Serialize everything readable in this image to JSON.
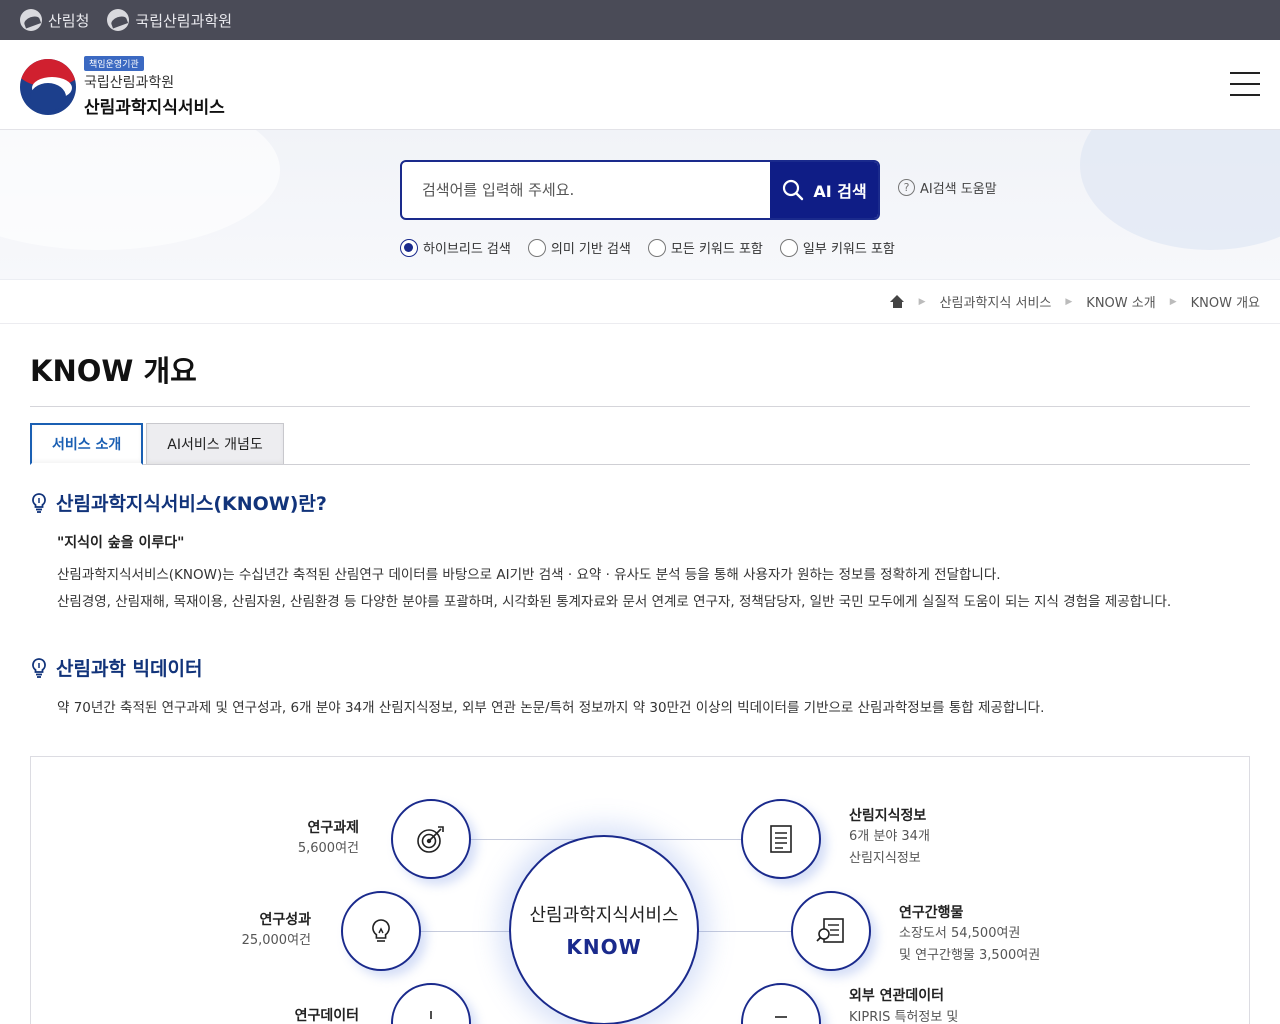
{
  "topbar": {
    "links": [
      "산림청",
      "국립산림과학원"
    ]
  },
  "header": {
    "badge": "책임운영기관",
    "org": "국립산림과학원",
    "service": "산림과학지식서비스"
  },
  "search": {
    "placeholder": "검색어를 입력해 주세요.",
    "button_label": "AI 검색",
    "help_label": "AI검색 도움말",
    "options": [
      "하이브리드 검색",
      "의미 기반 검색",
      "모든 키워드 포함",
      "일부 키워드 포함"
    ],
    "selected_option": "하이브리드 검색"
  },
  "breadcrumb": [
    "산림과학지식 서비스",
    "KNOW 소개",
    "KNOW 개요"
  ],
  "page": {
    "title": "KNOW 개요",
    "tabs": [
      "서비스 소개",
      "AI서비스 개념도"
    ],
    "active_tab": "서비스 소개"
  },
  "section1": {
    "heading": "산림과학지식서비스(KNOW)란?",
    "quote": "\"지식이 숲을 이루다\"",
    "p1": "산림과학지식서비스(KNOW)는 수십년간 축적된 산림연구 데이터를 바탕으로 AI기반 검색 · 요약 · 유사도 분석 등을 통해 사용자가 원하는 정보를 정확하게 전달합니다.",
    "p2": "산림경영, 산림재해, 목재이용, 산림자원, 산림환경 등 다양한 분야를 포괄하며, 시각화된 통계자료와 문서 연계로 연구자, 정책담당자, 일반 국민 모두에게 실질적 도움이 되는 지식 경험을 제공합니다."
  },
  "section2": {
    "heading": "산림과학 빅데이터",
    "text": "약 70년간 축적된 연구과제 및 연구성과, 6개 분야 34개 산림지식정보, 외부 연관 논문/특허 정보까지 약 30만건 이상의 빅데이터를 기반으로 산림과학정보를 통합 제공합니다."
  },
  "diagram": {
    "hub_title": "산림과학지식서비스",
    "hub_sub": "KNOW",
    "left": [
      {
        "title": "연구과제",
        "sub": "5,600여건"
      },
      {
        "title": "연구성과",
        "sub": "25,000여건"
      },
      {
        "title": "연구데이터",
        "sub": ""
      }
    ],
    "right": [
      {
        "title": "산림지식정보",
        "sub1": "6개 분야 34개",
        "sub2": "산림지식정보"
      },
      {
        "title": "연구간행물",
        "sub1": "소장도서 54,500여권",
        "sub2": "및 연구간행물 3,500여권"
      },
      {
        "title": "외부 연관데이터",
        "sub1": "KIPRIS 특허정보 및",
        "sub2": ""
      }
    ]
  }
}
